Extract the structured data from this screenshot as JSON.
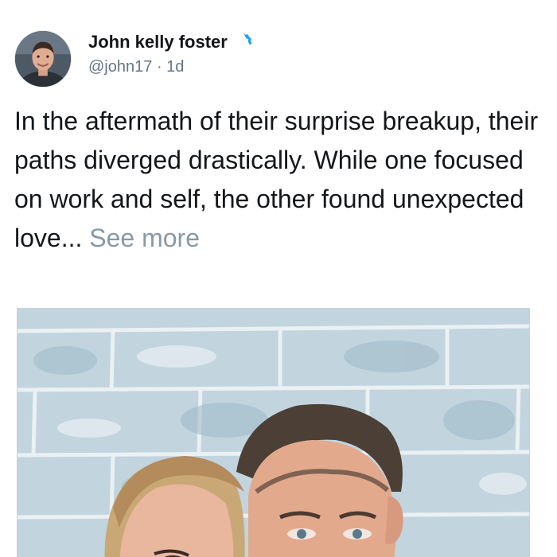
{
  "tweet": {
    "author": {
      "display_name": "John kelly foster",
      "handle": "@john17",
      "verified": true,
      "avatar_icon": "profile-photo-man"
    },
    "separator": "·",
    "timestamp": "1d",
    "text": "In the aftermath of their surprise breakup, their paths diverged drastically. While one focused on work and self, the other found unexpected love...",
    "see_more_label": "See more",
    "media": {
      "type": "photo",
      "description_icon": "couple-selfie-photo"
    }
  },
  "colors": {
    "text": "#14171a",
    "secondary": "#657786",
    "see_more": "#8899a6",
    "verified_badge": "#1da1f2",
    "media_border": "#c9d2d9"
  }
}
